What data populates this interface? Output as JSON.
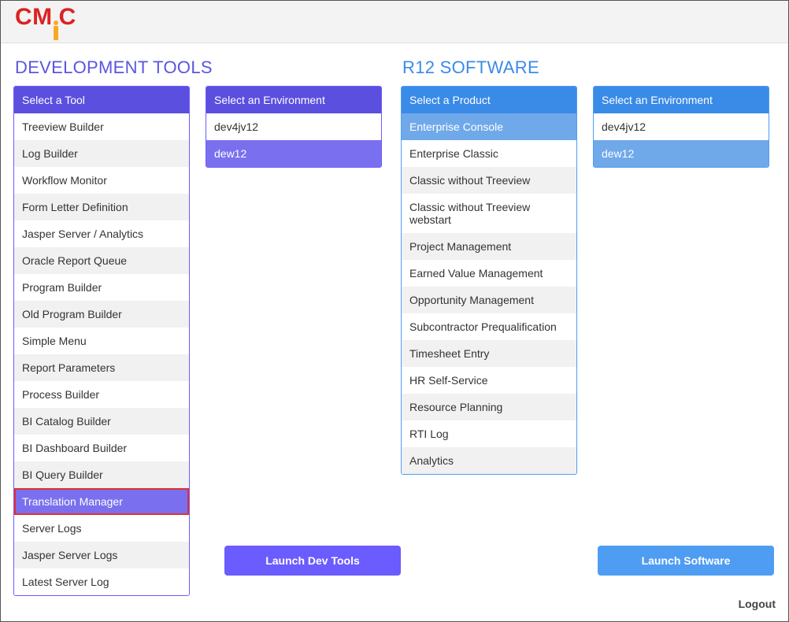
{
  "logo_text": "CMiC",
  "dev": {
    "title": "DEVELOPMENT TOOLS",
    "tool_header": "Select a Tool",
    "tools": [
      "Treeview Builder",
      "Log Builder",
      "Workflow Monitor",
      "Form Letter Definition",
      "Jasper Server / Analytics",
      "Oracle Report Queue",
      "Program Builder",
      "Old Program Builder",
      "Simple Menu",
      "Report Parameters",
      "Process Builder",
      "BI Catalog Builder",
      "BI Dashboard Builder",
      "BI Query Builder",
      "Translation Manager",
      "Server Logs",
      "Jasper Server Logs",
      "Latest Server Log"
    ],
    "selected_tool_index": 14,
    "highlighted_tool_index": 14,
    "env_header": "Select an Environment",
    "envs": [
      "dev4jv12",
      "dew12"
    ],
    "selected_env_index": 1,
    "launch_label": "Launch Dev Tools"
  },
  "r12": {
    "title": "R12 SOFTWARE",
    "product_header": "Select a Product",
    "products": [
      "Enterprise Console",
      "Enterprise Classic",
      "Classic without Treeview",
      "Classic without Treeview webstart",
      "Project Management",
      "Earned Value Management",
      "Opportunity Management",
      "Subcontractor Prequalification",
      "Timesheet Entry",
      "HR Self-Service",
      "Resource Planning",
      "RTI Log",
      "Analytics"
    ],
    "selected_product_index": 0,
    "env_header": "Select an Environment",
    "envs": [
      "dev4jv12",
      "dew12"
    ],
    "selected_env_index": 1,
    "launch_label": "Launch Software"
  },
  "logout_label": "Logout"
}
